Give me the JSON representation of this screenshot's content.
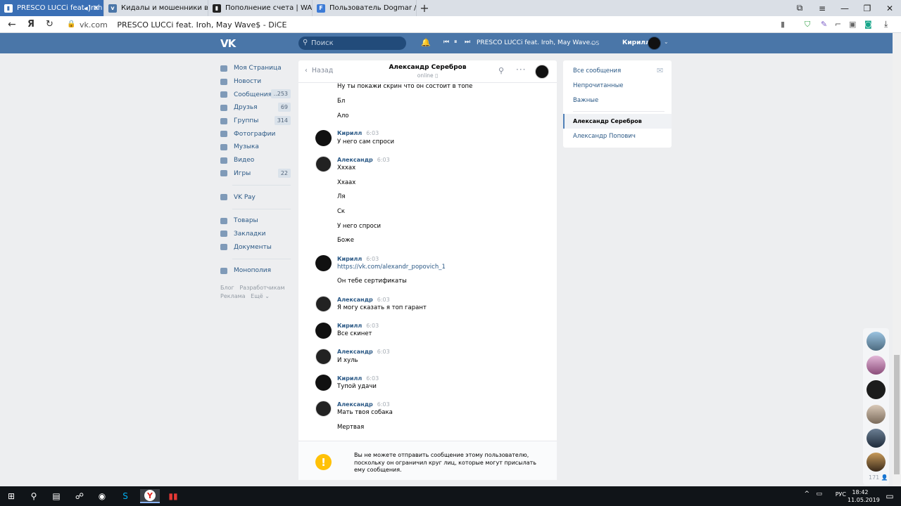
{
  "browser": {
    "tabs": [
      {
        "title": "PRESCO LUCCi feat. Iroh",
        "active": true,
        "favicon": "music-chart-icon"
      },
      {
        "title": "Кидалы и мошенники в vk",
        "active": false,
        "favicon": "vk-icon"
      },
      {
        "title": "Пополнение счета | WARF",
        "active": false,
        "favicon": "music-chart-icon"
      },
      {
        "title": "Пользователь Dogmar / F",
        "active": false,
        "favicon": "f-icon"
      }
    ],
    "domain": "vk.com",
    "page_title": "PRESCO LUCCi feat. Iroh, May Wave$ - DiCE",
    "yandex_label": "Я"
  },
  "header": {
    "logo": "VK",
    "search_placeholder": "Поиск",
    "player_track": "PRESCO LUCCi feat. Iroh, May Wave...",
    "player_extra": "OS",
    "user_name": "Кирилл"
  },
  "menu": {
    "items": [
      {
        "label": "Моя Страница",
        "count": ""
      },
      {
        "label": "Новости",
        "count": ""
      },
      {
        "label": "Сообщения",
        "count": "..253"
      },
      {
        "label": "Друзья",
        "count": "69"
      },
      {
        "label": "Группы",
        "count": "314"
      },
      {
        "label": "Фотографии",
        "count": ""
      },
      {
        "label": "Музыка",
        "count": ""
      },
      {
        "label": "Видео",
        "count": ""
      },
      {
        "label": "Игры",
        "count": "22"
      }
    ],
    "pay": "VK Pay",
    "extra": [
      "Товары",
      "Закладки",
      "Документы"
    ],
    "app": "Монополия",
    "footer": [
      "Блог",
      "Разработчикам",
      "Реклама",
      "Ещё"
    ]
  },
  "chat": {
    "back": "Назад",
    "name": "Александр Серебров",
    "status": "online",
    "messages": [
      {
        "author": "",
        "time": "",
        "lines": [
          "Ну ты покажи скрин что он состоит в топе",
          "Бл",
          "Ало"
        ]
      },
      {
        "author": "Кирилл",
        "time": "6:03",
        "lines": [
          "У него сам спроси"
        ]
      },
      {
        "author": "Александр",
        "time": "6:03",
        "lines": [
          "Хххах",
          "Ххаах",
          "Ля",
          "Ск",
          "У него спроси",
          "Боже"
        ]
      },
      {
        "author": "Кирилл",
        "time": "6:03",
        "lines": [
          "https://vk.com/alexandr_popovich_1",
          "Он тебе сертификаты"
        ]
      },
      {
        "author": "Александр",
        "time": "6:03",
        "lines": [
          "Я могу сказать я топ гарант"
        ]
      },
      {
        "author": "Кирилл",
        "time": "6:03",
        "lines": [
          "Все скинет"
        ]
      },
      {
        "author": "Александр",
        "time": "6:03",
        "lines": [
          "И хуль"
        ]
      },
      {
        "author": "Кирилл",
        "time": "6:03",
        "lines": [
          "Тупой удачи"
        ]
      },
      {
        "author": "Александр",
        "time": "6:03",
        "lines": [
          "Мать твоя собака",
          "Мертвая"
        ]
      }
    ],
    "warning": "Вы не можете отправить сообщение этому пользователю, поскольку он ограничил круг лиц, которые могут присылать ему сообщения."
  },
  "right_panel": {
    "filters": [
      "Все сообщения",
      "Непрочитанные",
      "Важные"
    ],
    "dialogs": [
      {
        "name": "Александр Серебров",
        "active": true
      },
      {
        "name": "Александр Попович",
        "active": false
      }
    ]
  },
  "friends_online": {
    "count": "171"
  },
  "taskbar": {
    "lang": "РУС",
    "time": "18:42",
    "date": "11.05.2019"
  },
  "colors": {
    "vk_blue": "#4a76a8",
    "link": "#2a5885",
    "background": "#edeef0",
    "warning": "#ffc107"
  }
}
